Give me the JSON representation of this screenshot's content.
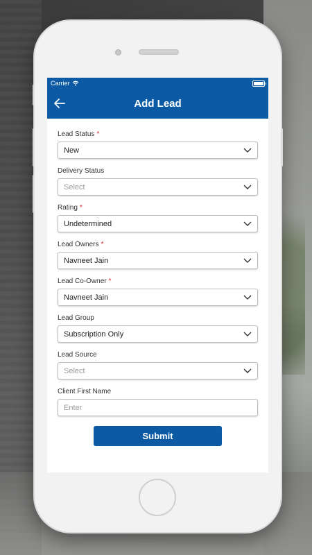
{
  "status_bar": {
    "carrier": "Carrier",
    "time": ""
  },
  "header": {
    "title": "Add Lead"
  },
  "form": {
    "fields": [
      {
        "label": "Lead Status",
        "required": "*",
        "value": "New",
        "placeholder": ""
      },
      {
        "label": "Delivery Status",
        "required": "",
        "value": "",
        "placeholder": "Select"
      },
      {
        "label": "Rating",
        "required": "*",
        "value": "Undetermined",
        "placeholder": ""
      },
      {
        "label": "Lead Owners",
        "required": "*",
        "value": "Navneet Jain",
        "placeholder": ""
      },
      {
        "label": "Lead Co-Owner",
        "required": "*",
        "value": "Navneet Jain",
        "placeholder": ""
      },
      {
        "label": "Lead Group",
        "required": "",
        "value": "Subscription Only",
        "placeholder": ""
      },
      {
        "label": "Lead Source",
        "required": "",
        "value": "",
        "placeholder": "Select"
      }
    ],
    "client_first_name": {
      "label": "Client First Name",
      "value": "",
      "placeholder": "Enter"
    },
    "submit_label": "Submit"
  },
  "colors": {
    "primary": "#0b5aa3",
    "required": "#d12a2a"
  },
  "icons": {
    "back": "arrow-left-icon",
    "dropdown": "chevron-down-icon",
    "wifi": "wifi-icon",
    "battery": "battery-icon"
  }
}
